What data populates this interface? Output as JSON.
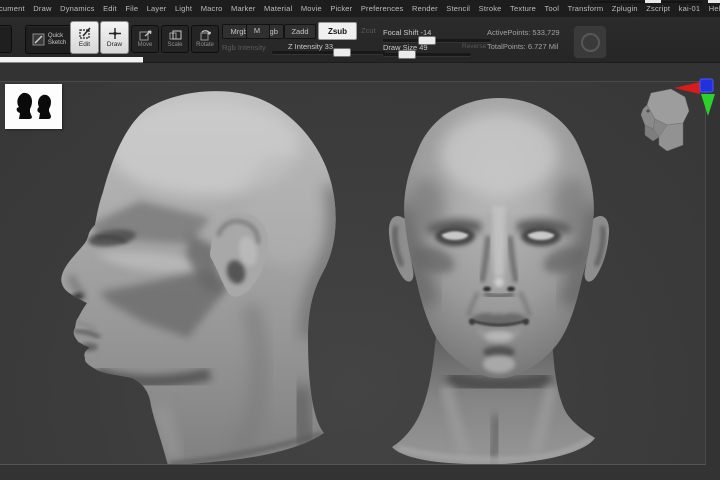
{
  "menubar": {
    "items": [
      "Document",
      "Draw",
      "Dynamics",
      "Edit",
      "File",
      "Layer",
      "Light",
      "Macro",
      "Marker",
      "Material",
      "Movie",
      "Picker",
      "Preferences",
      "Render",
      "Stencil",
      "Stroke",
      "Texture",
      "Tool",
      "Transform",
      "Zplugin",
      "Zscript",
      "kai-01",
      "Help"
    ]
  },
  "shelf": {
    "quick_sketch_l1": "Quick",
    "quick_sketch_l2": "Sketch",
    "edit": "Edit",
    "draw": "Draw",
    "move": "Move",
    "scale": "Scale",
    "rotate": "Rotate",
    "mrgb": "Mrgb",
    "rgb": "Rgb",
    "rgb_intensity": "Rgb Intensity",
    "m": "M",
    "zadd": "Zadd",
    "zsub": "Zsub",
    "zcut": "Zcut",
    "z_intensity_display": "Z Intensity 33",
    "z_intensity_value": 33,
    "focal_shift_display": "Focal Shift -14",
    "focal_shift_value": -14,
    "draw_size_display": "Draw Size 49",
    "draw_size_value": 49,
    "reverse": "Reverse",
    "active_points": "ActivePoints: 533,729",
    "total_points": "TotalPoints: 6.727 Mil"
  },
  "canvas": {
    "objects": [
      "sculpted-head-side-view",
      "sculpted-head-front-view"
    ],
    "tool_thumbnail": "dual-head-silhouette-thumbnail",
    "corner_preview": "low-poly-head-preview",
    "gizmo_colors": {
      "x": "#d81c1c",
      "y": "#2ad12a",
      "z": "#2231dd"
    }
  }
}
